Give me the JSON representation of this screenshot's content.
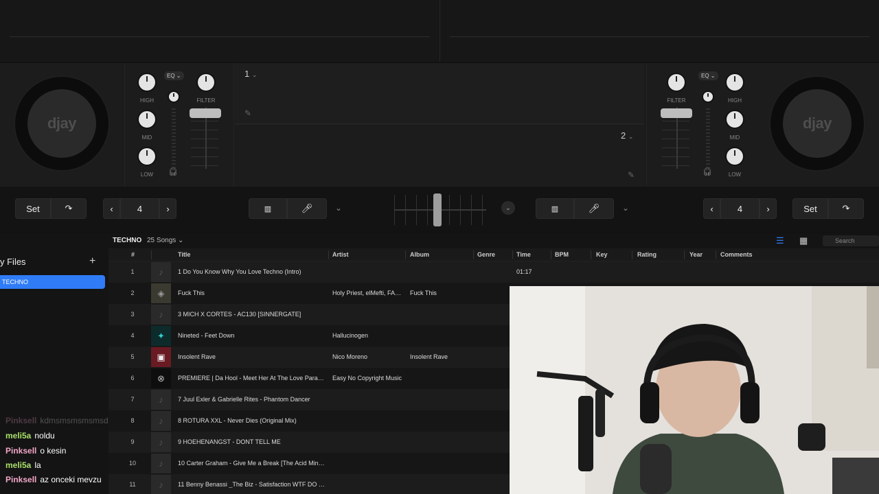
{
  "decks": {
    "left": {
      "logo": "djay",
      "eq_badge": "EQ",
      "high_label": "HIGH",
      "mid_label": "MID",
      "low_label": "LOW",
      "filter_label": "FILTER"
    },
    "right": {
      "logo": "djay",
      "eq_badge": "EQ",
      "high_label": "HIGH",
      "mid_label": "MID",
      "low_label": "LOW",
      "filter_label": "FILTER"
    },
    "center": {
      "deck1_num": "1",
      "deck2_num": "2"
    }
  },
  "transport": {
    "left": {
      "set_label": "Set",
      "beat_value": "4"
    },
    "right": {
      "set_label": "Set",
      "beat_value": "4"
    },
    "crossfader_position": 0.47
  },
  "sidebar": {
    "title": "y Files",
    "add_icon": "plus-icon",
    "items": [
      {
        "label": "TECHNO"
      }
    ]
  },
  "library": {
    "playlist": "TECHNO",
    "count": "25 Songs",
    "search_placeholder": "Search",
    "columns": [
      "#",
      "Title",
      "Artist",
      "Album",
      "Genre",
      "Time",
      "BPM",
      "Key",
      "Rating",
      "Year",
      "Comments"
    ],
    "rows": [
      {
        "n": "1",
        "title": "1 Do You Know Why You Love Techno (Intro)",
        "artist": "",
        "album": "",
        "time": "01:17"
      },
      {
        "n": "2",
        "title": "Fuck This",
        "artist": "Holy Priest, elMefti, FAC...",
        "album": "Fuck This",
        "time": ""
      },
      {
        "n": "3",
        "title": "3 MICH X CORTES - AC130 [SINNERGATE]",
        "artist": "",
        "album": "",
        "time": ""
      },
      {
        "n": "4",
        "title": "Nineted - Feet Down",
        "artist": "Hallucinogen",
        "album": "",
        "time": ""
      },
      {
        "n": "5",
        "title": "Insolent Rave",
        "artist": "Nico Moreno",
        "album": "Insolent Rave",
        "time": ""
      },
      {
        "n": "6",
        "title": "PREMIERE | Da Hool - Meet Her At The Love Parade (...",
        "artist": "Easy No Copyright Music",
        "album": "",
        "time": ""
      },
      {
        "n": "7",
        "title": "7 Juul Exler & Gabrielle Rites -  Phantom Dancer",
        "artist": "",
        "album": "",
        "time": ""
      },
      {
        "n": "8",
        "title": "8 ROTURA XXL - Never Dies (Original Mix)",
        "artist": "",
        "album": "",
        "time": ""
      },
      {
        "n": "9",
        "title": "9 HOEHENANGST - DONT TELL ME",
        "artist": "",
        "album": "",
        "time": ""
      },
      {
        "n": "10",
        "title": "10 Carter Graham - Give Me a  Break [The Acid Mind ...",
        "artist": "",
        "album": "",
        "time": ""
      },
      {
        "n": "11",
        "title": "11 Benny Benassi _The Biz - Satisfaction WTF DO DJs ...",
        "artist": "",
        "album": "",
        "time": ""
      }
    ]
  },
  "chat": [
    {
      "user": "Pinksell",
      "msg": "kdmsmsmsmsmsd",
      "color": "#f2a7c8",
      "faded": true
    },
    {
      "user": "meli5a",
      "msg": "noldu",
      "color": "#a8e06a",
      "faded": false
    },
    {
      "user": "Pinksell",
      "msg": "o kesin",
      "color": "#f2a7c8",
      "faded": false
    },
    {
      "user": "meli5a",
      "msg": "la",
      "color": "#a8e06a",
      "faded": false
    },
    {
      "user": "Pinksell",
      "msg": "az onceki mevzu",
      "color": "#f2a7c8",
      "faded": false
    }
  ],
  "colors": {
    "accent": "#2f7cf6"
  }
}
